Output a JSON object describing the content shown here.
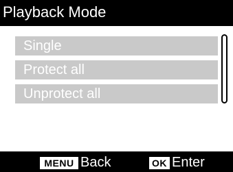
{
  "title": "Playback Mode",
  "menu": {
    "items": [
      {
        "label": "Single"
      },
      {
        "label": "Protect all"
      },
      {
        "label": "Unprotect all"
      }
    ]
  },
  "footer": {
    "back_key": "MENU",
    "back_label": "Back",
    "enter_key": "OK",
    "enter_label": "Enter"
  },
  "colors": {
    "title_bar_bg": "#000000",
    "item_bg": "#c9c9c9",
    "item_text": "#ffffff",
    "footer_bg": "#000000"
  }
}
